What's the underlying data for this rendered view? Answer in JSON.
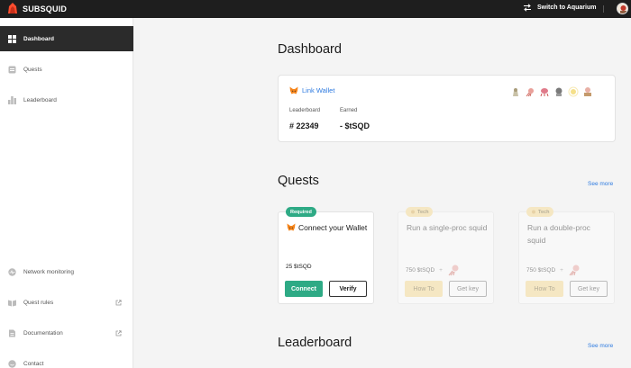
{
  "app": {
    "name": "SUBSQUID"
  },
  "topbar": {
    "switch_label": "Switch to Aquarium"
  },
  "sidebar": {
    "items": [
      {
        "label": "Dashboard"
      },
      {
        "label": "Quests"
      },
      {
        "label": "Leaderboard"
      },
      {
        "label": "Network monitoring"
      },
      {
        "label": "Quest rules"
      },
      {
        "label": "Documentation"
      },
      {
        "label": "Contact"
      }
    ]
  },
  "dashboard": {
    "title": "Dashboard",
    "link_wallet": "Link Wallet",
    "leaderboard_label": "Leaderboard",
    "leaderboard_value": "# 22349",
    "earned_label": "Earned",
    "earned_value": "- $tSQD"
  },
  "quests": {
    "title": "Quests",
    "see_more": "See more",
    "cards": [
      {
        "tag": "Required",
        "title": "Connect your Wallet",
        "reward": "25 $tSQD",
        "primary": "Connect",
        "secondary": "Verify"
      },
      {
        "tag": "Tech",
        "title": "Run a single-proc squid",
        "reward": "750 $tSQD",
        "plus": "+",
        "primary": "How To",
        "secondary": "Get key"
      },
      {
        "tag": "Tech",
        "title": "Run a double-proc squid",
        "reward": "750 $tSQD",
        "plus": "+",
        "primary": "How To",
        "secondary": "Get key"
      }
    ]
  },
  "leaderboard": {
    "title": "Leaderboard",
    "see_more": "See more"
  },
  "colors": {
    "accent": "#2d7ae0",
    "green": "#2eaa85",
    "yellow": "#f8d98a",
    "dark": "#1e1e1e"
  }
}
